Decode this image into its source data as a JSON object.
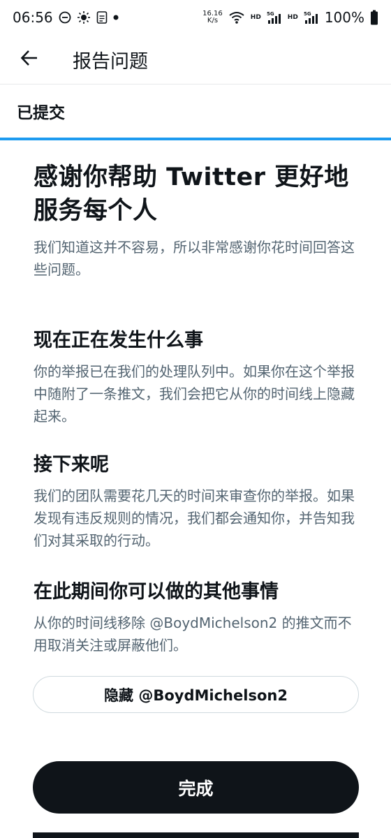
{
  "status_bar": {
    "time": "06:56",
    "network_speed_value": "16.16",
    "network_speed_unit": "K/s",
    "hd1": "HD",
    "hd2": "HD",
    "battery": "100%"
  },
  "app_bar": {
    "title": "报告问题"
  },
  "tab": {
    "label": "已提交",
    "progress": 1.0
  },
  "main": {
    "headline": "感谢你帮助 Twitter 更好地服务每个人",
    "intro": "我们知道这并不容易，所以非常感谢你花时间回答这些问题。",
    "sections": [
      {
        "title": "现在正在发生什么事",
        "text": "你的举报已在我们的处理队列中。如果你在这个举报中随附了一条推文，我们会把它从你的时间线上隐藏起来。"
      },
      {
        "title": "接下来呢",
        "text": "我们的团队需要花几天的时间来审查你的举报。如果发现有违反规则的情况，我们都会通知你，并告知我们对其采取的行动。"
      },
      {
        "title": "在此期间你可以做的其他事情",
        "text": "从你的时间线移除 @BoydMichelson2 的推文而不用取消关注或屏蔽他们。"
      }
    ]
  },
  "buttons": {
    "hide_label": "隐藏 @BoydMichelson2",
    "done_label": "完成"
  },
  "colors": {
    "accent": "#1d9bf0",
    "text_primary": "#0f1419",
    "text_secondary": "#536471",
    "button_dark": "#0f1419"
  }
}
